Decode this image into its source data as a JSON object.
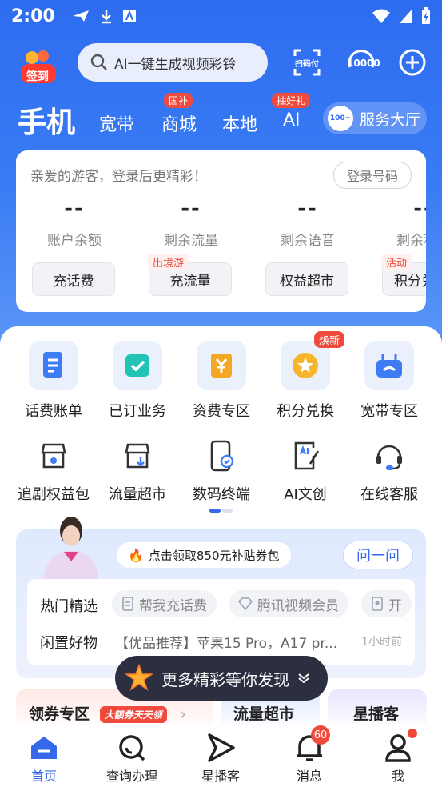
{
  "status_bar": {
    "time": "2:00"
  },
  "top": {
    "signin_label": "签到",
    "search_placeholder": "AI一键生成视频彩铃",
    "scan_label": "扫码付",
    "hotline_label": "10000"
  },
  "tabs": [
    {
      "label": "手机"
    },
    {
      "label": "宽带"
    },
    {
      "label": "商城",
      "badge": "国补"
    },
    {
      "label": "本地"
    },
    {
      "label": "AI",
      "badge": "抽好礼"
    }
  ],
  "service_hall": {
    "label": "服务大厅",
    "icon_text": "100+"
  },
  "account_card": {
    "greeting": "亲爱的游客，登录后更精彩！",
    "login_button": "登录号码",
    "stats": [
      {
        "value": "--",
        "label": "账户余额"
      },
      {
        "value": "--",
        "label": "剩余流量"
      },
      {
        "value": "--",
        "label": "剩余语音"
      },
      {
        "value": "--",
        "label": "剩余积分"
      }
    ],
    "quick_buttons": [
      {
        "label": "充话费",
        "tag": ""
      },
      {
        "label": "充流量",
        "tag": "出境游"
      },
      {
        "label": "权益超市",
        "tag": ""
      },
      {
        "label": "积分兑",
        "tag": "活动"
      }
    ]
  },
  "services_row1": [
    {
      "label": "话费账单",
      "icon": "bill-icon"
    },
    {
      "label": "已订业务",
      "icon": "subscribed-icon"
    },
    {
      "label": "资费专区",
      "icon": "tariff-icon"
    },
    {
      "label": "积分兑换",
      "icon": "points-icon",
      "badge": "焕新"
    },
    {
      "label": "宽带专区",
      "icon": "router-icon"
    }
  ],
  "services_row2": [
    {
      "label": "追剧权益包",
      "icon": "drama-icon"
    },
    {
      "label": "流量超市",
      "icon": "data-market-icon"
    },
    {
      "label": "数码终端",
      "icon": "phone-icon"
    },
    {
      "label": "AI文创",
      "icon": "ai-doc-icon"
    },
    {
      "label": "在线客服",
      "icon": "headset-icon"
    }
  ],
  "recommend": {
    "promo_text": "点击领取850元补贴券包",
    "ask_button": "问一问",
    "hot_label": "热门精选",
    "chips": [
      "帮我充话费",
      "腾讯视频会员",
      "开"
    ],
    "used_label": "闲置好物",
    "used_item": "【优品推荐】苹果15 Pro，A17 pr...",
    "used_time": "1小时前"
  },
  "more_button": "更多精彩等你发现",
  "sections": [
    {
      "label": "领券专区",
      "tag": "大额券天天领"
    },
    {
      "label": "流量超市"
    },
    {
      "label": "星播客"
    }
  ],
  "bottom_nav": [
    {
      "label": "首页",
      "icon": "home-icon"
    },
    {
      "label": "查询办理",
      "icon": "search-icon"
    },
    {
      "label": "星播客",
      "icon": "play-icon"
    },
    {
      "label": "消息",
      "icon": "bell-icon",
      "badge": "60"
    },
    {
      "label": "我",
      "icon": "user-icon"
    }
  ],
  "colors": {
    "accent": "#3569ea",
    "hero": "#2d6cf0",
    "badge": "#f04a3c"
  }
}
